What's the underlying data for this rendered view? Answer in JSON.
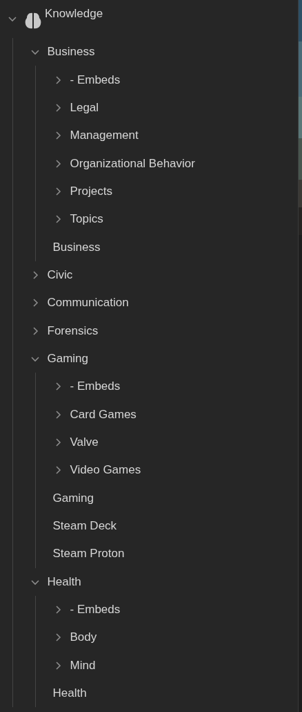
{
  "tree": {
    "label": "Knowledge",
    "kind": "folder",
    "expanded": true,
    "children": [
      {
        "label": "Business",
        "kind": "folder",
        "expanded": true,
        "children": [
          {
            "label": "- Embeds",
            "kind": "folder",
            "expanded": false
          },
          {
            "label": "Legal",
            "kind": "folder",
            "expanded": false
          },
          {
            "label": "Management",
            "kind": "folder",
            "expanded": false
          },
          {
            "label": "Organizational Behavior",
            "kind": "folder",
            "expanded": false
          },
          {
            "label": "Projects",
            "kind": "folder",
            "expanded": false
          },
          {
            "label": "Topics",
            "kind": "folder",
            "expanded": false
          },
          {
            "label": "Business",
            "kind": "note"
          }
        ]
      },
      {
        "label": "Civic",
        "kind": "folder",
        "expanded": false
      },
      {
        "label": "Communication",
        "kind": "folder",
        "expanded": false
      },
      {
        "label": "Forensics",
        "kind": "folder",
        "expanded": false
      },
      {
        "label": "Gaming",
        "kind": "folder",
        "expanded": true,
        "children": [
          {
            "label": "- Embeds",
            "kind": "folder",
            "expanded": false
          },
          {
            "label": "Card Games",
            "kind": "folder",
            "expanded": false
          },
          {
            "label": "Valve",
            "kind": "folder",
            "expanded": false
          },
          {
            "label": "Video Games",
            "kind": "folder",
            "expanded": false
          },
          {
            "label": "Gaming",
            "kind": "note"
          },
          {
            "label": "Steam Deck",
            "kind": "note"
          },
          {
            "label": "Steam Proton",
            "kind": "note"
          }
        ]
      },
      {
        "label": "Health",
        "kind": "folder",
        "expanded": true,
        "children": [
          {
            "label": "- Embeds",
            "kind": "folder",
            "expanded": false
          },
          {
            "label": "Body",
            "kind": "folder",
            "expanded": false
          },
          {
            "label": "Mind",
            "kind": "folder",
            "expanded": false
          },
          {
            "label": "Health",
            "kind": "note"
          }
        ]
      }
    ]
  }
}
